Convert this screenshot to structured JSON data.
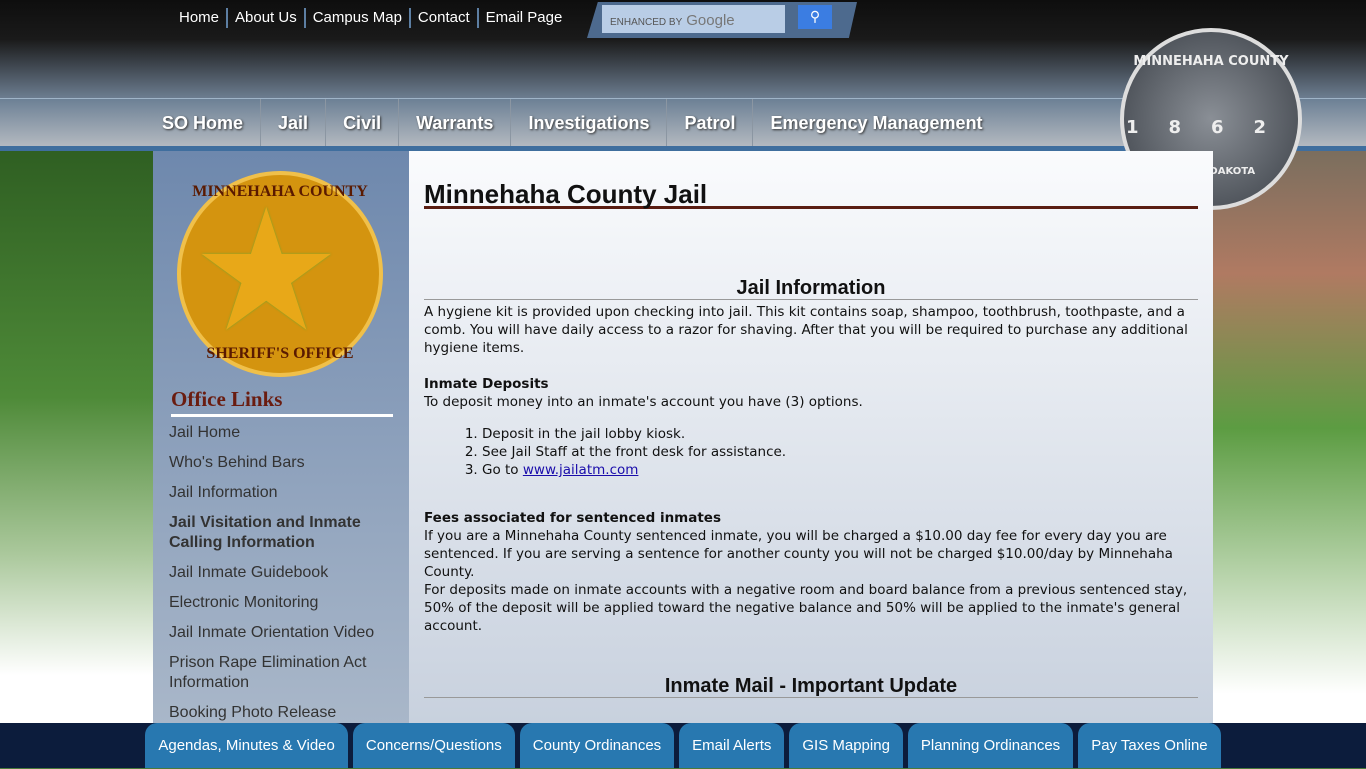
{
  "utility_nav": [
    "Home",
    "About Us",
    "Campus Map",
    "Contact",
    "Email Page"
  ],
  "search": {
    "enhanced_by": "ENHANCED BY",
    "brand": "Google",
    "button_icon": "search-icon"
  },
  "main_nav": [
    "SO Home",
    "Jail",
    "Civil",
    "Warrants",
    "Investigations",
    "Patrol",
    "Emergency Management"
  ],
  "county_seal": {
    "name": "MINNEHAHA COUNTY",
    "year": "1862",
    "state": "SOUTH DAKOTA"
  },
  "sheriff_badge": {
    "top": "MINNEHAHA COUNTY",
    "bottom": "SHERIFF'S OFFICE"
  },
  "sidebar": {
    "heading": "Office Links",
    "items": [
      "Jail Home",
      "Who's Behind Bars",
      "Jail Information",
      "Jail Visitation and Inmate Calling Information",
      "Jail Inmate Guidebook",
      "Electronic Monitoring",
      "Jail Inmate Orientation Video",
      "Prison Rape Elimination Act Information",
      "Booking Photo Release"
    ]
  },
  "main": {
    "title": "Minnehaha County Jail",
    "section1": "Jail Information",
    "hygiene": "A hygiene kit is provided upon checking into jail. This kit contains soap, shampoo, toothbrush, toothpaste, and a comb. You will have daily access to a razor for shaving. After that you will be required to purchase any additional hygiene items.",
    "deposits_heading": "Inmate Deposits",
    "deposits_intro": "To deposit money into an inmate's account you have (3) options.",
    "options": [
      "Deposit in the jail lobby kiosk.",
      "See Jail Staff at the front desk for assistance.",
      "Go to "
    ],
    "link": "www.jailatm.com",
    "fees_heading": "Fees associated for sentenced inmates",
    "fees1": "If you are a Minnehaha County sentenced inmate, you will be charged a $10.00 day fee for every day you are sentenced. If you are serving a sentence for another county you will not be charged $10.00/day by Minnehaha County.",
    "fees2": "For deposits made on inmate accounts with a negative room and board balance from a previous sentenced stay, 50% of the deposit will be applied toward the negative balance and 50% will be applied to the inmate's general account.",
    "section2": "Inmate Mail - Important Update"
  },
  "footer": [
    "Agendas, Minutes & Video",
    "Concerns/Questions",
    "County Ordinances",
    "Email Alerts",
    "GIS Mapping",
    "Planning Ordinances",
    "Pay Taxes Online"
  ]
}
